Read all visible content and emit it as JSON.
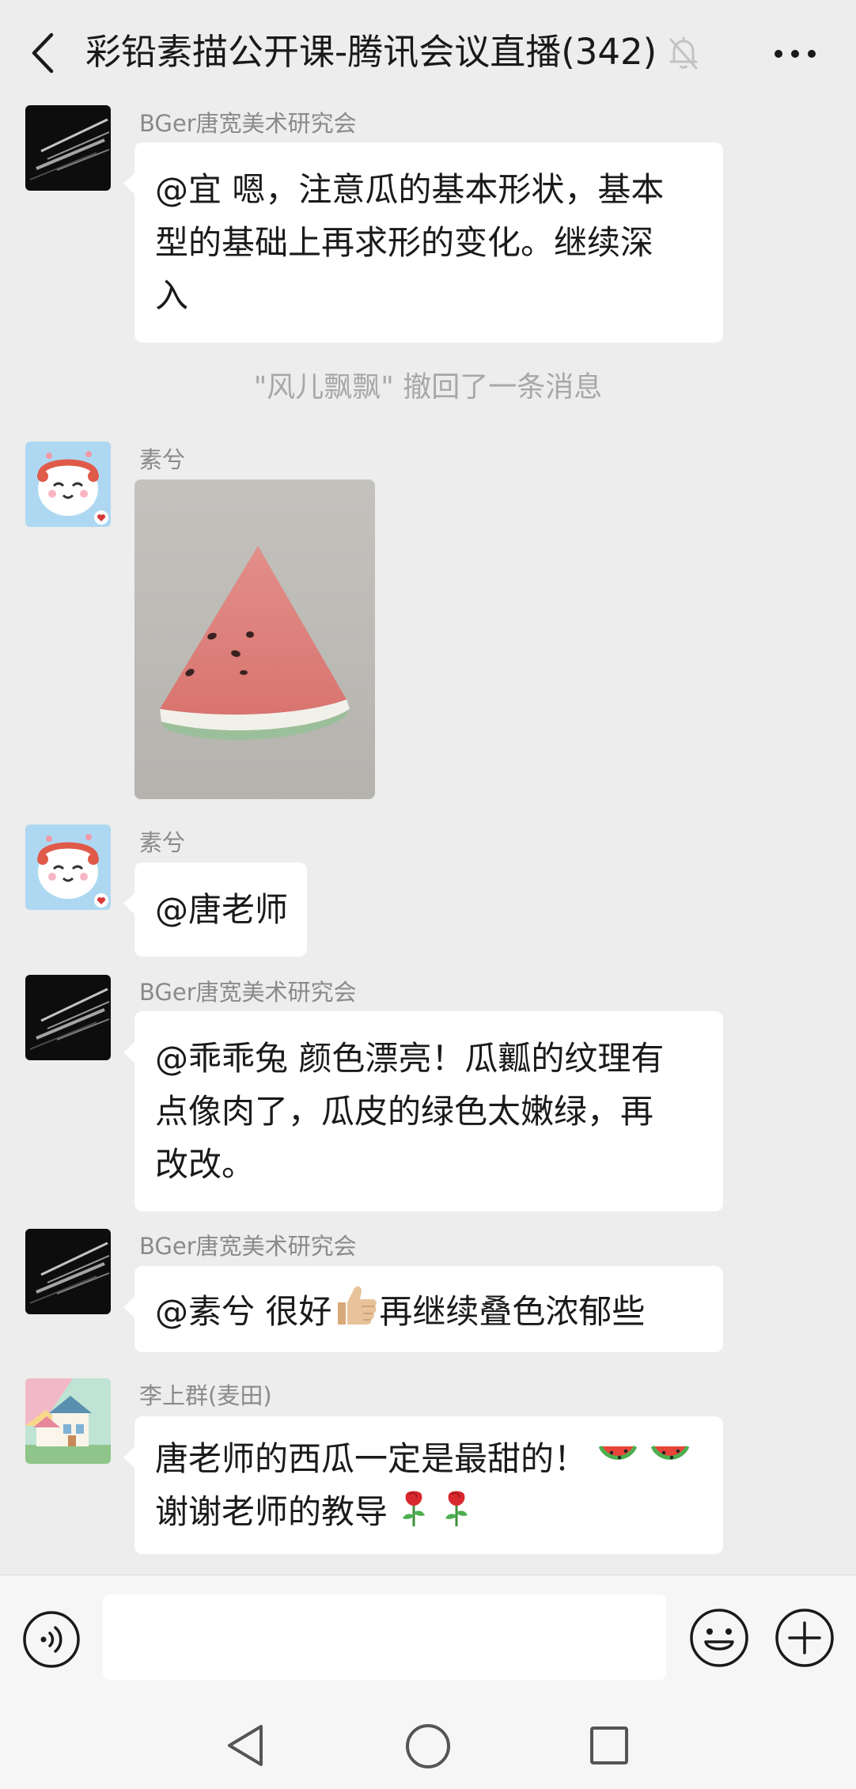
{
  "header": {
    "title": "彩铅素描公开课-腾讯会议直播(342)",
    "back_icon": "chevron-left-icon",
    "mute_icon": "bell-off-icon",
    "more_icon": "more-horizontal-icon"
  },
  "messages": [
    {
      "sender": "BGer唐宽美术研究会",
      "avatar": "dark-light-streaks",
      "lines": [
        "@宜 嗯，注意瓜的基本形状，基本",
        "型的基础上再求形的变化。继续深",
        "入"
      ]
    },
    {
      "system": "\"风儿飘飘\" 撤回了一条消息"
    },
    {
      "sender": "素兮",
      "avatar": "cartoon-cat",
      "image": "watermelon-slice-drawing"
    },
    {
      "sender": "素兮",
      "avatar": "cartoon-cat",
      "lines": [
        "@唐老师"
      ]
    },
    {
      "sender": "BGer唐宽美术研究会",
      "avatar": "dark-light-streaks",
      "lines": [
        "@乖乖兔 颜色漂亮！瓜瓤的纹理有",
        "点像肉了，瓜皮的绿色太嫩绿，再",
        "改改。"
      ]
    },
    {
      "sender": "BGer唐宽美术研究会",
      "avatar": "dark-light-streaks",
      "text_before_emoji": "@素兮 很好",
      "emoji": "thumbs-up-icon",
      "text_after_emoji": "再继续叠色浓郁些"
    },
    {
      "sender": "李上群(麦田)",
      "avatar": "cartoon-house",
      "line1": "唐老师的西瓜一定是最甜的！",
      "line1_emoji": [
        "watermelon-icon",
        "watermelon-icon"
      ],
      "line2": "谢谢老师的教导",
      "line2_emoji": [
        "rose-icon",
        "rose-icon"
      ]
    }
  ],
  "input_bar": {
    "voice_icon": "voice-input-icon",
    "text_value": "",
    "emoji_icon": "smiley-icon",
    "plus_icon": "plus-circle-icon"
  },
  "nav_bar": {
    "back_icon": "triangle-back-icon",
    "home_icon": "circle-home-icon",
    "recent_icon": "square-recents-icon"
  },
  "colors": {
    "background": "#ededed",
    "bubble": "#ffffff",
    "sender_text": "#8a8a8a",
    "system_text": "#a8a8a8"
  }
}
